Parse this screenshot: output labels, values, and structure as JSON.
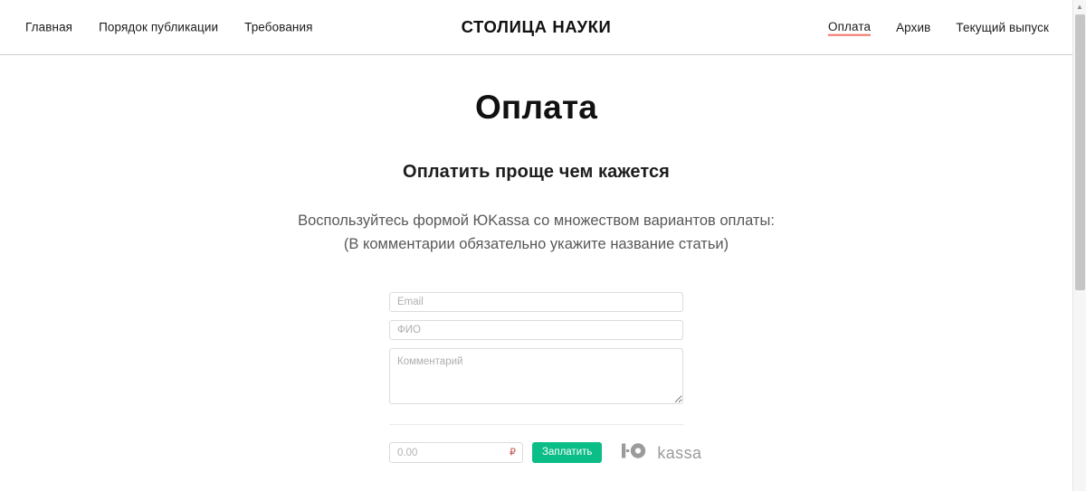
{
  "header": {
    "brand": "СТОЛИЦА НАУКИ",
    "nav_left": [
      {
        "label": "Главная",
        "active": false
      },
      {
        "label": "Порядок публикации",
        "active": false
      },
      {
        "label": "Требования",
        "active": false
      }
    ],
    "nav_right": [
      {
        "label": "Оплата",
        "active": true
      },
      {
        "label": "Архив",
        "active": false
      },
      {
        "label": "Текущий выпуск",
        "active": false
      }
    ],
    "active_underline_color": "#f5736a"
  },
  "main": {
    "title": "Оплата",
    "subtitle": "Оплатить проще чем кажется",
    "intro_line_1": "Воспользуйтесь формой ЮKassa со множеством вариантов оплаты:",
    "intro_line_2": "(В комментарии обязательно укажите название статьи)"
  },
  "form": {
    "email_placeholder": "Email",
    "email_value": "",
    "fullname_placeholder": "ФИО",
    "fullname_value": "",
    "comment_placeholder": "Комментарий",
    "comment_value": "",
    "amount_placeholder": "0.00",
    "amount_value": "",
    "currency_symbol": "₽",
    "pay_button_label": "Заплатить",
    "pay_button_color": "#0bbd87",
    "provider_name": "kassa",
    "provider_logo_icon": "yookassa-logo-icon"
  },
  "scrollbar": {
    "up_arrow_icon": "chevron-up-icon"
  }
}
